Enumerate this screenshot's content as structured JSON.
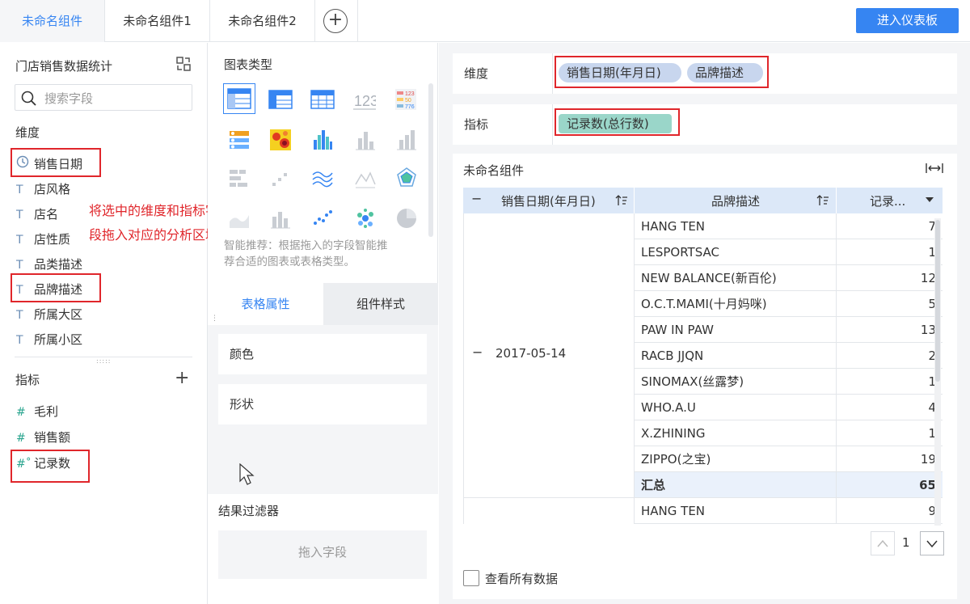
{
  "tabs": [
    "未命名组件",
    "未命名组件1",
    "未命名组件2"
  ],
  "add_tab": "+",
  "enter_dashboard": "进入仪表板",
  "left": {
    "title": "门店销售数据统计",
    "search_placeholder": "搜索字段",
    "dimension_heading": "维度",
    "dimensions": [
      "销售日期",
      "店风格",
      "店名",
      "店性质",
      "品类描述",
      "品牌描述",
      "所属大区",
      "所属小区"
    ],
    "metric_heading": "指标",
    "metrics": [
      "毛利",
      "销售额",
      "记录数"
    ],
    "annotation_line1": "将选中的维度和指标字",
    "annotation_line2": "段拖入对应的分析区域"
  },
  "middle": {
    "chart_type_heading": "图表类型",
    "recommend_text_line1": "智能推荐：根据拖入的字段智能推",
    "recommend_text_line2": "荐合适的图表或表格类型。",
    "tab_table_props": "表格属性",
    "tab_component_style": "组件样式",
    "color_label": "颜色",
    "shape_label": "形状",
    "result_filter_heading": "结果过滤器",
    "drop_field_placeholder": "拖入字段"
  },
  "right": {
    "dimension_label": "维度",
    "dimension_pills": [
      "销售日期(年月日)",
      "品牌描述"
    ],
    "metric_label": "指标",
    "metric_pills": [
      "记录数(总行数)"
    ],
    "component_title": "未命名组件",
    "table": {
      "headers": [
        "销售日期(年月日)",
        "品牌描述",
        "记录..."
      ],
      "collapse_symbol": "−",
      "group_date": "2017-05-14",
      "rows": [
        {
          "brand": "HANG TEN",
          "count": "7"
        },
        {
          "brand": "LESPORTSAC",
          "count": "1"
        },
        {
          "brand": "NEW BALANCE(新百伦)",
          "count": "12"
        },
        {
          "brand": "O.C.T.MAMI(十月妈咪)",
          "count": "5"
        },
        {
          "brand": "PAW IN PAW",
          "count": "13"
        },
        {
          "brand": "RACB JJQN",
          "count": "2"
        },
        {
          "brand": "SINOMAX(丝露梦)",
          "count": "1"
        },
        {
          "brand": "WHO.A.U",
          "count": "4"
        },
        {
          "brand": "X.ZHINING",
          "count": "1"
        },
        {
          "brand": "ZIPPO(之宝)",
          "count": "19"
        }
      ],
      "subtotal_label": "汇总",
      "subtotal_value": "65",
      "next_row": {
        "brand": "HANG TEN",
        "count": "9"
      }
    },
    "page_number": "1",
    "view_all_label": "查看所有数据"
  },
  "colors": {
    "accent": "#3685f2",
    "highlight_red": "#e0262b",
    "dimension_pill": "#c8d6ee",
    "metric_pill": "#9ad6c9",
    "table_header": "#dce8f8",
    "subtotal_row": "#eaf1fb"
  }
}
